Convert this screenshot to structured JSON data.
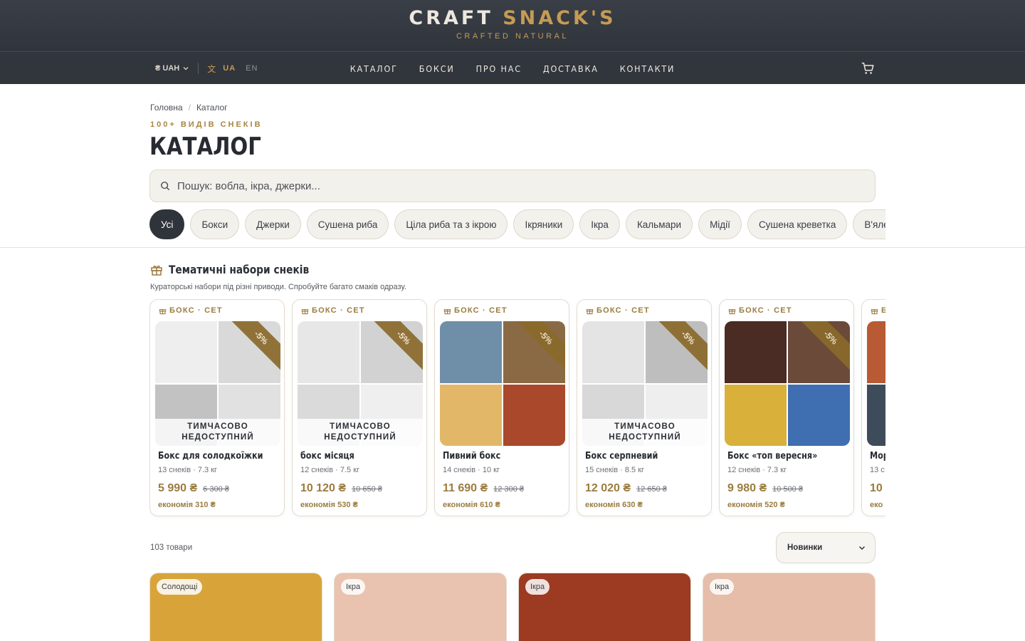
{
  "brand": {
    "word1": "CRAFT",
    "word2": "SNACK'S",
    "tagline": "CRAFTED NATURAL"
  },
  "nav": {
    "currency": "₴ UAH",
    "languages": [
      {
        "code": "UA",
        "active": true
      },
      {
        "code": "EN",
        "active": false
      }
    ],
    "links": [
      "КАТАЛОГ",
      "БОКСИ",
      "ПРО НАС",
      "ДОСТАВКА",
      "КОНТАКТИ"
    ]
  },
  "breadcrumb": [
    "Головна",
    "Каталог"
  ],
  "catalog": {
    "eyebrow": "100+ ВИДІВ СНЕКІВ",
    "title": "КАТАЛОГ",
    "search_placeholder": "Пошук: вобла, ікра, джерки..."
  },
  "chips": [
    {
      "label": "Усі",
      "active": true
    },
    {
      "label": "Бокси",
      "active": false
    },
    {
      "label": "Джерки",
      "active": false
    },
    {
      "label": "Сушена риба",
      "active": false
    },
    {
      "label": "Ціла риба та з ікрою",
      "active": false
    },
    {
      "label": "Ікряники",
      "active": false
    },
    {
      "label": "Ікра",
      "active": false
    },
    {
      "label": "Кальмари",
      "active": false
    },
    {
      "label": "Мідії",
      "active": false
    },
    {
      "label": "Сушена креветка",
      "active": false
    },
    {
      "label": "В'ялене м'ясо",
      "active": false
    }
  ],
  "boxes_section": {
    "title": "Тематичні набори снеків",
    "subtitle": "Кураторські набори під різні приводи. Спробуйте багато смаків одразу.",
    "tag": "БОКС · СЕТ",
    "unavailable": "ТИМЧАСОВО НЕДОСТУПНИЙ",
    "items": [
      {
        "name": "Бокс для солодкоїжки",
        "meta": "13 снеків · 7.3 кг",
        "price": "5 990 ₴",
        "old_price": "6 300 ₴",
        "saving": "економія 310 ₴",
        "discount": "-5%",
        "available": false,
        "tiles": [
          "#cfcfcf",
          "#bdbdbd",
          "#a9a9a9",
          "#c4c4c4"
        ]
      },
      {
        "name": "бокс місяця",
        "meta": "12 снеків · 7.5 кг",
        "price": "10 120 ₴",
        "old_price": "10 650 ₴",
        "saving": "економія 530 ₴",
        "discount": "-5%",
        "available": false,
        "tiles": [
          "#c9c9c9",
          "#b7b7b7",
          "#bebebe",
          "#d0d0d0"
        ]
      },
      {
        "name": "Пивний бокс",
        "meta": "14 снеків · 10 кг",
        "price": "11 690 ₴",
        "old_price": "12 300 ₴",
        "saving": "економія 610 ₴",
        "discount": "-5%",
        "available": true,
        "tiles": [
          "#6f8fa8",
          "#8a6a45",
          "#e2b868",
          "#a9482a"
        ]
      },
      {
        "name": "Бокс серпневий",
        "meta": "15 снеків · 8.5 кг",
        "price": "12 020 ₴",
        "old_price": "12 650 ₴",
        "saving": "економія 630 ₴",
        "discount": "-5%",
        "available": false,
        "tiles": [
          "#c6c6c6",
          "#a5a5a5",
          "#bcbcbc",
          "#cfcfcf"
        ]
      },
      {
        "name": "Бокс «топ вересня»",
        "meta": "12 снеків · 7.3 кг",
        "price": "9 980 ₴",
        "old_price": "10 500 ₴",
        "saving": "економія 520 ₴",
        "discount": "-5%",
        "available": true,
        "tiles": [
          "#4a2c24",
          "#6b4a3a",
          "#d9b13a",
          "#3f6fb0"
        ]
      },
      {
        "name": "Мор",
        "meta": "13 с",
        "price": "10",
        "old_price": "",
        "saving": "еко",
        "discount": "",
        "available": true,
        "tiles": [
          "#b85a34",
          "#a84a2a",
          "#3e4b5a",
          "#c06a3a"
        ]
      }
    ]
  },
  "listing": {
    "count": "103 товари",
    "sort": "Новинки",
    "products": [
      {
        "badge": "Солодощі",
        "color": "#d8a43a"
      },
      {
        "badge": "Ікра",
        "color": "#e9c2b0"
      },
      {
        "badge": "Ікра",
        "color": "#9c3a22"
      },
      {
        "badge": "Ікра",
        "color": "#e5bda8"
      }
    ]
  },
  "colors": {
    "accent": "#c59b55",
    "dark": "#31353c",
    "gold_text": "#9b7c3f"
  }
}
